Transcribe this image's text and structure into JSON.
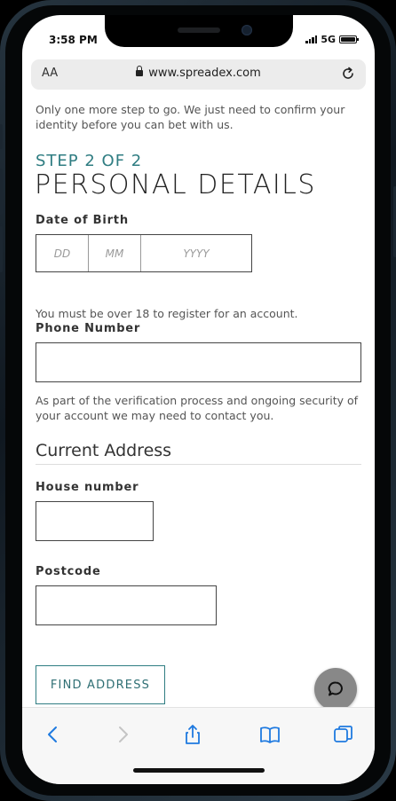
{
  "status": {
    "time": "3:58 PM",
    "network": "5G"
  },
  "browser": {
    "text_size_label": "AA",
    "url": "www.spreadex.com"
  },
  "page": {
    "intro": "Only one more step to go. We just need to confirm your identity before you can bet with us.",
    "step": "STEP 2 OF 2",
    "title": "PERSONAL DETAILS",
    "dob": {
      "label": "Date of Birth",
      "day_placeholder": "DD",
      "month_placeholder": "MM",
      "year_placeholder": "YYYY",
      "note": "You must be over 18 to register for an account."
    },
    "phone": {
      "label": "Phone Number",
      "value": "",
      "note": "As part of the verification process and ongoing security of your account we may need to contact you."
    },
    "address": {
      "heading": "Current Address",
      "house_label": "House number",
      "house_value": "",
      "postcode_label": "Postcode",
      "postcode_value": "",
      "find_button": "FIND ADDRESS"
    }
  },
  "toolbar": {
    "icons": [
      "back-icon",
      "forward-icon",
      "share-icon",
      "bookmarks-icon",
      "tabs-icon"
    ]
  },
  "colors": {
    "accent": "#2f7d82",
    "toolbar_icon": "#1f7ae0",
    "chat_button": "#888888"
  }
}
